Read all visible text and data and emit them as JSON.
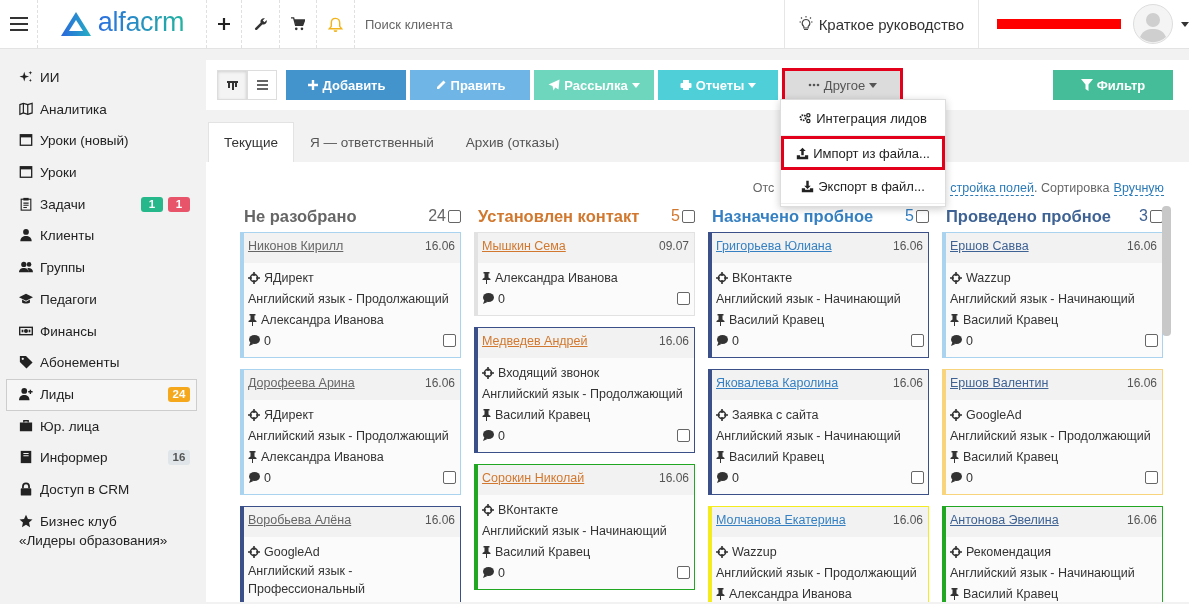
{
  "header": {
    "logo": "alfacrm",
    "search": {
      "placeholder": "Поиск клиента"
    },
    "guide": "Краткое руководство",
    "user": {
      "redacted": true
    }
  },
  "sidebar": {
    "items": [
      {
        "label": "ИИ",
        "selected": false
      },
      {
        "label": "Аналитика",
        "selected": false
      },
      {
        "label": "Уроки (новый)",
        "selected": false
      },
      {
        "label": "Уроки",
        "selected": false
      },
      {
        "label": "Задачи",
        "selected": false,
        "badges": [
          {
            "text": "1",
            "color": "#26b88a"
          },
          {
            "text": "1",
            "color": "#e8546a"
          }
        ]
      },
      {
        "label": "Клиенты",
        "selected": false
      },
      {
        "label": "Группы",
        "selected": false
      },
      {
        "label": "Педагоги",
        "selected": false
      },
      {
        "label": "Финансы",
        "selected": false
      },
      {
        "label": "Абонементы",
        "selected": false
      },
      {
        "label": "Лиды",
        "selected": true,
        "badges": [
          {
            "text": "24",
            "color": "#f5a81c"
          }
        ]
      },
      {
        "label": "Юр. лица",
        "selected": false
      },
      {
        "label": "Информер",
        "selected": false,
        "badges": [
          {
            "text": "16",
            "color": "#dfe5e8"
          }
        ]
      },
      {
        "label": "Доступ в CRM",
        "selected": false
      },
      {
        "label": "Бизнес клуб\n«Лидеры образования»",
        "selected": false
      }
    ]
  },
  "toolbar": {
    "views": [
      {
        "selected": true
      },
      {
        "selected": false
      }
    ],
    "buttons": [
      {
        "label": "Добавить",
        "color": "#4393cc",
        "dropdown": false,
        "highlighted": false
      },
      {
        "label": "Править",
        "color": "#6fb5e6",
        "dropdown": false,
        "highlighted": false
      },
      {
        "label": "Рассылка",
        "color": "#6fd6be",
        "dropdown": true,
        "highlighted": false
      },
      {
        "label": "Отчеты",
        "color": "#4fcfd8",
        "dropdown": true,
        "highlighted": false
      },
      {
        "label": "Другое",
        "color": "#dcdcdc",
        "dropdown": true,
        "highlighted": true
      }
    ],
    "filter": {
      "label": "Фильтр",
      "color": "#45bd98"
    }
  },
  "menu": {
    "items": [
      {
        "label": "Интеграция лидов",
        "highlighted": false
      },
      {
        "label": "Импорт из файла...",
        "highlighted": true
      },
      {
        "label": "Экспорт в файл...",
        "highlighted": false
      }
    ]
  },
  "tabs": [
    {
      "label": "Текущие",
      "selected": true
    },
    {
      "label": "Я — ответственный",
      "selected": false
    },
    {
      "label": "Архив (отказы)",
      "selected": false
    }
  ],
  "board": {
    "settings": {
      "prefix": "Отс",
      "fields_link": "стройка полей",
      "sort_label": ". Сортировка",
      "sort_link": "Вручную"
    },
    "columns": [
      {
        "title": "Не разобрано",
        "count": "24",
        "color": "#666666",
        "checked": false,
        "cards": [
          {
            "name": "Никонов Кирилл",
            "date": "16.06",
            "color": "#a9d3ee",
            "source": "ЯДирект",
            "course": "Английский язык - Продолжающий",
            "responsible": "Александра Иванова",
            "comments": "0",
            "checked": false
          },
          {
            "name": "Дорофеева Арина",
            "date": "16.06",
            "color": "#a9d3ee",
            "source": "ЯДирект",
            "course": "Английский язык - Продолжающий",
            "responsible": "Александра Иванова",
            "comments": "0",
            "checked": false
          },
          {
            "name": "Воробьева Алёна",
            "date": "16.06",
            "color": "#3b5089",
            "source": "GoogleAd",
            "course": "Английский язык - Профессиональный"
          }
        ]
      },
      {
        "title": "Установлен контакт",
        "count": "5",
        "color": "#d2782e",
        "checked": false,
        "cards": [
          {
            "name": "Мышкин Сема",
            "date": "09.07",
            "color": "#e2e2e2",
            "responsible": "Александра Иванова",
            "comments": "0",
            "checked": false
          },
          {
            "name": "Медведев Андрей",
            "date": "16.06",
            "color": "#3b5089",
            "source": "Входящий звонок",
            "course": "Английский язык - Продолжающий",
            "responsible": "Василий Кравец",
            "comments": "0",
            "checked": false
          },
          {
            "name": "Сорокин Николай",
            "date": "16.06",
            "color": "#22a722",
            "source": "ВКонтакте",
            "course": "Английский язык - Начинающий",
            "responsible": "Василий Кравец",
            "comments": "0",
            "checked": false
          }
        ]
      },
      {
        "title": "Назначено пробное",
        "count": "5",
        "color": "#3580c2",
        "checked": false,
        "cards": [
          {
            "name": "Григорьева Юлиана",
            "date": "16.06",
            "color": "#3b5089",
            "source": "ВКонтакте",
            "course": "Английский язык - Начинающий",
            "responsible": "Василий Кравец",
            "comments": "0",
            "checked": false
          },
          {
            "name": "Яковалева Каролина",
            "date": "16.06",
            "color": "#3b5089",
            "source": "Заявка с сайта",
            "course": "Английский язык - Начинающий",
            "responsible": "Василий Кравец",
            "comments": "0",
            "checked": false
          },
          {
            "name": "Молчанова Екатерина",
            "date": "16.06",
            "color": "#f4ec1e",
            "source": "Wazzup",
            "course": "Английский язык - Продолжающий",
            "responsible": "Александра Иванова"
          }
        ]
      },
      {
        "title": "Проведено пробное",
        "count": "3",
        "color": "#3e6293",
        "checked": false,
        "cards": [
          {
            "name": "Ершов Савва",
            "date": "16.06",
            "color": "#a9d3ee",
            "source": "Wazzup",
            "course": "Английский язык - Начинающий",
            "responsible": "Василий Кравец",
            "comments": "0",
            "checked": false
          },
          {
            "name": "Ершов Валентин",
            "date": "16.06",
            "color": "#f8d47c",
            "source": "GoogleAd",
            "course": "Английский язык - Продолжающий",
            "responsible": "Василий Кравец",
            "comments": "0",
            "checked": false
          },
          {
            "name": "Антонова Эвелина",
            "date": "16.06",
            "color": "#22a722",
            "source": "Рекомендация",
            "course": "Английский язык - Начинающий",
            "responsible": "Василий Кравец"
          }
        ]
      }
    ]
  }
}
